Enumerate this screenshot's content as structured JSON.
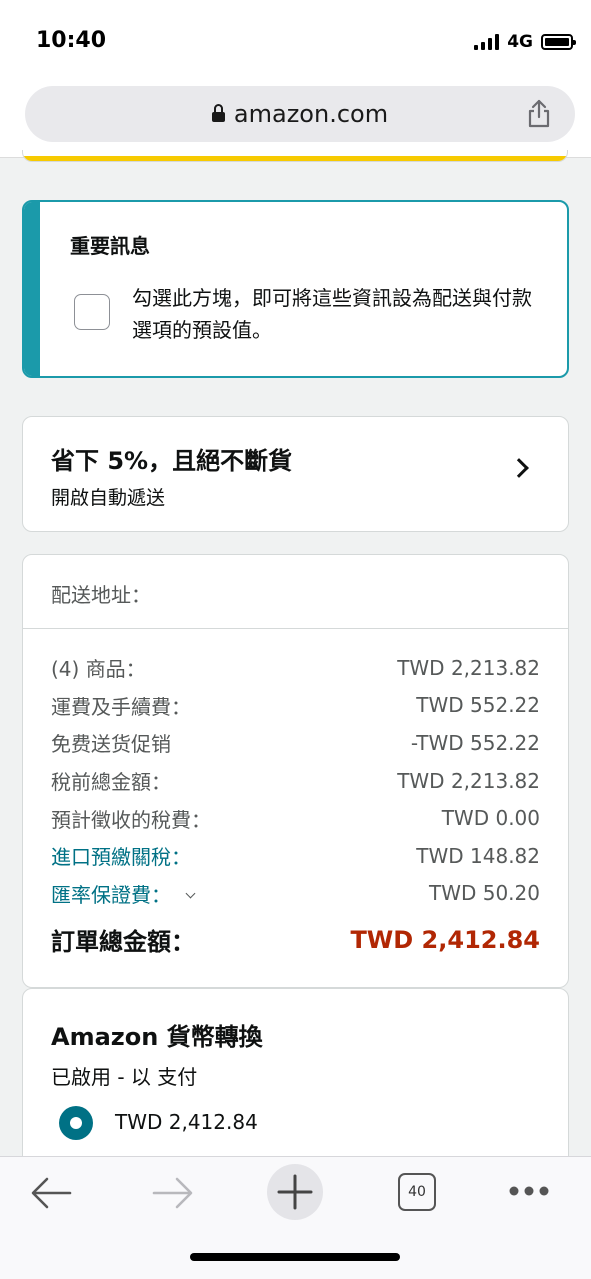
{
  "status_bar": {
    "time": "10:40",
    "network": "4G"
  },
  "browser": {
    "url": "amazon.com",
    "tab_count": "40"
  },
  "notice": {
    "title": "重要訊息",
    "text": "勾選此方塊，即可將這些資訊設為配送與付款選項的預設值。",
    "checked": false
  },
  "subscribe": {
    "title": "省下 5%，且絕不斷貨",
    "subtitle": "開啟自動遞送"
  },
  "summary": {
    "address_label": "配送地址：",
    "lines": [
      {
        "label": "(4) 商品：",
        "value": "TWD 2,213.82"
      },
      {
        "label": "運費及手續費：",
        "value": "TWD 552.22"
      },
      {
        "label": "免费送货促销",
        "value": "-TWD 552.22"
      },
      {
        "label": "稅前總金額：",
        "value": "TWD 2,213.82"
      },
      {
        "label": "預計徵收的稅費：",
        "value": "TWD 0.00"
      },
      {
        "label": "進口預繳關稅：",
        "value": "TWD 148.82"
      },
      {
        "label": "匯率保證費：",
        "value": "TWD 50.20"
      }
    ],
    "total_label": "訂單總金額：",
    "total_value": "TWD 2,412.84"
  },
  "currency": {
    "title": "Amazon 貨幣轉換",
    "subtitle": "已啟用 - 以 支付",
    "option_label": "TWD 2,412.84",
    "selected": true
  },
  "colors": {
    "accent_teal": "#1b9aaa",
    "link": "#007185",
    "price_red": "#b12704",
    "yellow": "#f7ca00"
  }
}
